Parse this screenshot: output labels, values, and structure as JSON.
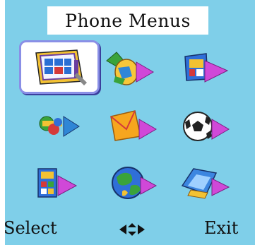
{
  "header": {
    "title": "Phone Menus"
  },
  "menu": {
    "selected_index": 0,
    "items": [
      {
        "icon": "phonebook-icon"
      },
      {
        "icon": "call-log-icon"
      },
      {
        "icon": "multimedia-icon"
      },
      {
        "icon": "settings-icon"
      },
      {
        "icon": "messages-icon"
      },
      {
        "icon": "games-icon"
      },
      {
        "icon": "organizer-icon"
      },
      {
        "icon": "internet-icon"
      },
      {
        "icon": "profiles-icon"
      }
    ]
  },
  "softkeys": {
    "left": "Select",
    "right": "Exit",
    "center_icon": "navigation-arrows-icon"
  },
  "colors": {
    "background": "#7fcfe9",
    "highlight_border": "#8a8fe6",
    "arrow": "#d048d8"
  }
}
